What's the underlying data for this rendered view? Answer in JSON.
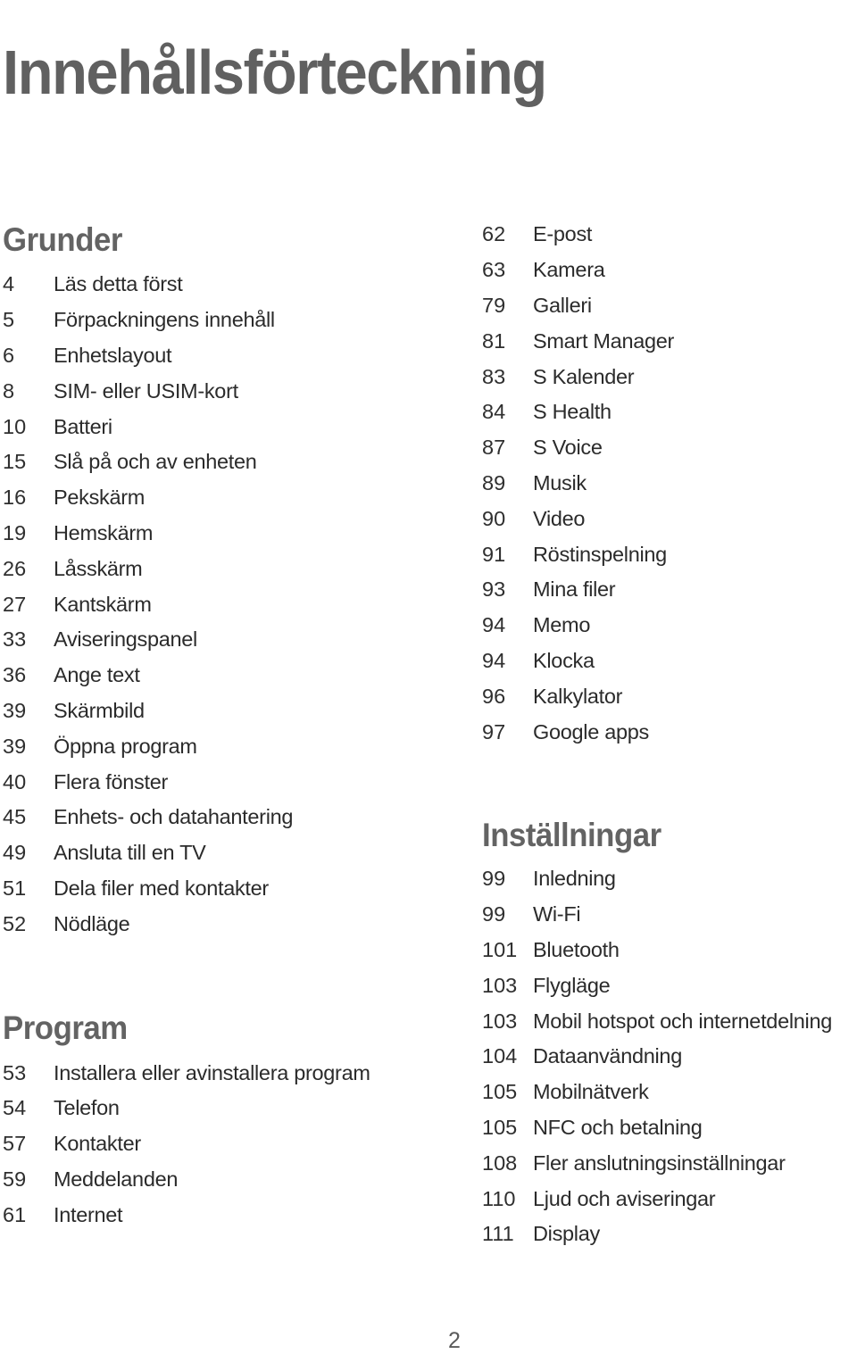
{
  "document": {
    "title": "Innehållsförteckning",
    "page_number": "2"
  },
  "left_column": {
    "sections": [
      {
        "heading": "Grunder",
        "items": [
          {
            "page": "4",
            "label": "Läs detta först"
          },
          {
            "page": "5",
            "label": "Förpackningens innehåll"
          },
          {
            "page": "6",
            "label": "Enhetslayout"
          },
          {
            "page": "8",
            "label": "SIM- eller USIM-kort"
          },
          {
            "page": "10",
            "label": "Batteri"
          },
          {
            "page": "15",
            "label": "Slå på och av enheten"
          },
          {
            "page": "16",
            "label": "Pekskärm"
          },
          {
            "page": "19",
            "label": "Hemskärm"
          },
          {
            "page": "26",
            "label": "Låsskärm"
          },
          {
            "page": "27",
            "label": "Kantskärm"
          },
          {
            "page": "33",
            "label": "Aviseringspanel"
          },
          {
            "page": "36",
            "label": "Ange text"
          },
          {
            "page": "39",
            "label": "Skärmbild"
          },
          {
            "page": "39",
            "label": "Öppna program"
          },
          {
            "page": "40",
            "label": "Flera fönster"
          },
          {
            "page": "45",
            "label": "Enhets- och datahantering"
          },
          {
            "page": "49",
            "label": "Ansluta till en TV"
          },
          {
            "page": "51",
            "label": "Dela filer med kontakter"
          },
          {
            "page": "52",
            "label": "Nödläge"
          }
        ]
      },
      {
        "heading": "Program",
        "items": [
          {
            "page": "53",
            "label": "Installera eller avinstallera program"
          },
          {
            "page": "54",
            "label": "Telefon"
          },
          {
            "page": "57",
            "label": "Kontakter"
          },
          {
            "page": "59",
            "label": "Meddelanden"
          },
          {
            "page": "61",
            "label": "Internet"
          }
        ]
      }
    ]
  },
  "right_column": {
    "continued_items": [
      {
        "page": "62",
        "label": "E-post"
      },
      {
        "page": "63",
        "label": "Kamera"
      },
      {
        "page": "79",
        "label": "Galleri"
      },
      {
        "page": "81",
        "label": "Smart Manager"
      },
      {
        "page": "83",
        "label": "S Kalender"
      },
      {
        "page": "84",
        "label": "S Health"
      },
      {
        "page": "87",
        "label": "S Voice"
      },
      {
        "page": "89",
        "label": "Musik"
      },
      {
        "page": "90",
        "label": "Video"
      },
      {
        "page": "91",
        "label": "Röstinspelning"
      },
      {
        "page": "93",
        "label": "Mina filer"
      },
      {
        "page": "94",
        "label": "Memo"
      },
      {
        "page": "94",
        "label": "Klocka"
      },
      {
        "page": "96",
        "label": "Kalkylator"
      },
      {
        "page": "97",
        "label": "Google apps"
      }
    ],
    "sections": [
      {
        "heading": "Inställningar",
        "items": [
          {
            "page": "99",
            "label": "Inledning"
          },
          {
            "page": "99",
            "label": "Wi-Fi"
          },
          {
            "page": "101",
            "label": "Bluetooth"
          },
          {
            "page": "103",
            "label": "Flygläge"
          },
          {
            "page": "103",
            "label": "Mobil hotspot och internetdelning"
          },
          {
            "page": "104",
            "label": "Dataanvändning"
          },
          {
            "page": "105",
            "label": "Mobilnätverk"
          },
          {
            "page": "105",
            "label": "NFC och betalning"
          },
          {
            "page": "108",
            "label": "Fler anslutningsinställningar"
          },
          {
            "page": "110",
            "label": "Ljud och aviseringar"
          },
          {
            "page": "111",
            "label": "Display"
          }
        ]
      }
    ]
  },
  "colors": {
    "title": "#606060",
    "heading": "#636363",
    "body_text": "#2b2b2b",
    "background": "#ffffff"
  }
}
